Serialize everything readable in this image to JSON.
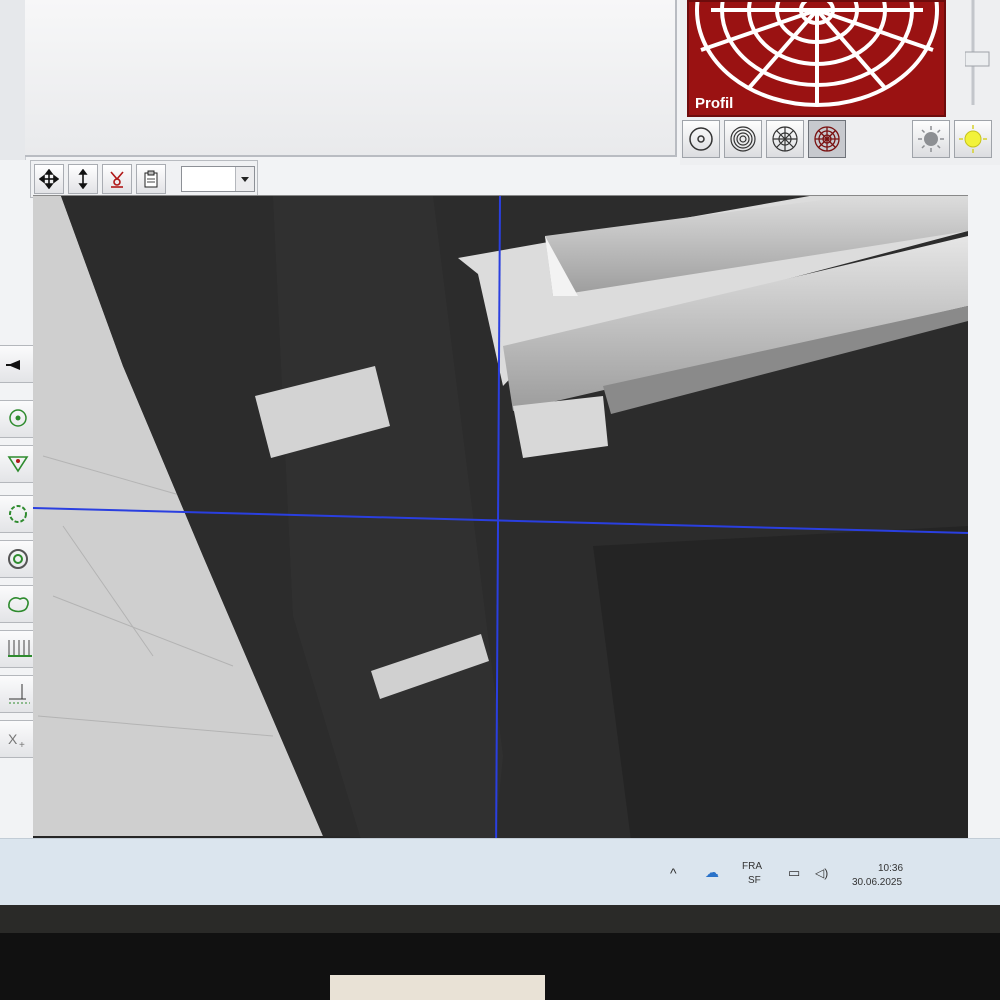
{
  "app": {
    "profile_view": {
      "label": "Profil",
      "bg_color": "#9a1212"
    },
    "mode_buttons": [
      {
        "icon": "single-ring-icon"
      },
      {
        "icon": "concentric-rings-icon"
      },
      {
        "icon": "radial-segments-icon"
      },
      {
        "icon": "full-profile-icon"
      }
    ],
    "light_buttons": [
      {
        "icon": "light-off-icon"
      },
      {
        "icon": "light-on-icon",
        "color": "#f2f23a"
      }
    ],
    "toolbar": {
      "buttons": [
        {
          "icon": "move-icon"
        },
        {
          "icon": "vertical-arrow-icon"
        },
        {
          "icon": "probe-icon"
        },
        {
          "icon": "clipboard-icon"
        }
      ],
      "zoom_select": {
        "value": ""
      }
    },
    "side_tools": [
      {
        "icon": "pointer-icon"
      },
      {
        "icon": "center-point-icon"
      },
      {
        "icon": "triangle-point-icon"
      },
      {
        "icon": "circle-icon"
      },
      {
        "icon": "concentric-circle-icon"
      },
      {
        "icon": "contour-icon"
      },
      {
        "icon": "grid-measure-icon"
      },
      {
        "icon": "axis-icon"
      },
      {
        "icon": "xy-icon"
      }
    ],
    "crosshair_color": "#2a3fe0"
  },
  "taskbar": {
    "language_top": "FRA",
    "language_bottom": "SF",
    "time": "10:36",
    "date": "30.06.2025"
  }
}
